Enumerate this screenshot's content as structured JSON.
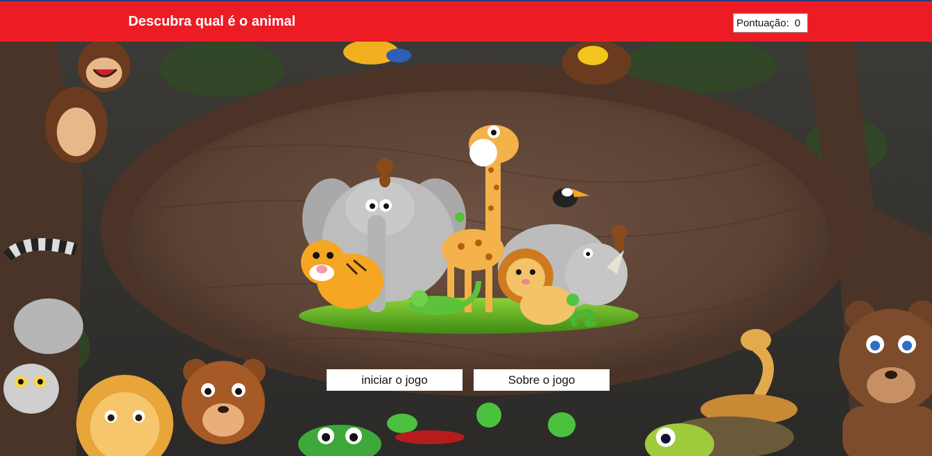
{
  "header": {
    "title": "Descubra qual é o animal",
    "score_label": "Pontuação:",
    "score_value": "0"
  },
  "menu": {
    "start_label": "iniciar o jogo",
    "about_label": "Sobre o jogo"
  },
  "colors": {
    "header_bg": "#ed1c24",
    "button_bg": "#ffffff"
  },
  "scene": {
    "background": "jungle-wooden-frame",
    "center_art": "safari-animals-group",
    "animals": [
      "elephant",
      "giraffe",
      "tiger",
      "lion",
      "rhino",
      "monkey",
      "toucan",
      "lizard",
      "snake",
      "frog",
      "frog-small"
    ],
    "border_characters": [
      "monkey",
      "lemur",
      "lion-cub",
      "bear-cub",
      "bear",
      "snake",
      "frogs",
      "toucan",
      "turtle",
      "fish-green"
    ]
  }
}
